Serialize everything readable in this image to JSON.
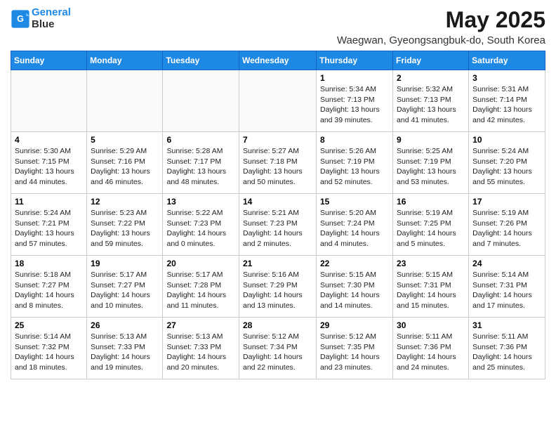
{
  "logo": {
    "line1": "General",
    "line2": "Blue"
  },
  "title": "May 2025",
  "subtitle": "Waegwan, Gyeongsangbuk-do, South Korea",
  "days_header": [
    "Sunday",
    "Monday",
    "Tuesday",
    "Wednesday",
    "Thursday",
    "Friday",
    "Saturday"
  ],
  "weeks": [
    [
      {
        "num": "",
        "info": "",
        "empty": true
      },
      {
        "num": "",
        "info": "",
        "empty": true
      },
      {
        "num": "",
        "info": "",
        "empty": true
      },
      {
        "num": "",
        "info": "",
        "empty": true
      },
      {
        "num": "1",
        "info": "Sunrise: 5:34 AM\nSunset: 7:13 PM\nDaylight: 13 hours\nand 39 minutes."
      },
      {
        "num": "2",
        "info": "Sunrise: 5:32 AM\nSunset: 7:13 PM\nDaylight: 13 hours\nand 41 minutes."
      },
      {
        "num": "3",
        "info": "Sunrise: 5:31 AM\nSunset: 7:14 PM\nDaylight: 13 hours\nand 42 minutes."
      }
    ],
    [
      {
        "num": "4",
        "info": "Sunrise: 5:30 AM\nSunset: 7:15 PM\nDaylight: 13 hours\nand 44 minutes."
      },
      {
        "num": "5",
        "info": "Sunrise: 5:29 AM\nSunset: 7:16 PM\nDaylight: 13 hours\nand 46 minutes."
      },
      {
        "num": "6",
        "info": "Sunrise: 5:28 AM\nSunset: 7:17 PM\nDaylight: 13 hours\nand 48 minutes."
      },
      {
        "num": "7",
        "info": "Sunrise: 5:27 AM\nSunset: 7:18 PM\nDaylight: 13 hours\nand 50 minutes."
      },
      {
        "num": "8",
        "info": "Sunrise: 5:26 AM\nSunset: 7:19 PM\nDaylight: 13 hours\nand 52 minutes."
      },
      {
        "num": "9",
        "info": "Sunrise: 5:25 AM\nSunset: 7:19 PM\nDaylight: 13 hours\nand 53 minutes."
      },
      {
        "num": "10",
        "info": "Sunrise: 5:24 AM\nSunset: 7:20 PM\nDaylight: 13 hours\nand 55 minutes."
      }
    ],
    [
      {
        "num": "11",
        "info": "Sunrise: 5:24 AM\nSunset: 7:21 PM\nDaylight: 13 hours\nand 57 minutes."
      },
      {
        "num": "12",
        "info": "Sunrise: 5:23 AM\nSunset: 7:22 PM\nDaylight: 13 hours\nand 59 minutes."
      },
      {
        "num": "13",
        "info": "Sunrise: 5:22 AM\nSunset: 7:23 PM\nDaylight: 14 hours\nand 0 minutes."
      },
      {
        "num": "14",
        "info": "Sunrise: 5:21 AM\nSunset: 7:23 PM\nDaylight: 14 hours\nand 2 minutes."
      },
      {
        "num": "15",
        "info": "Sunrise: 5:20 AM\nSunset: 7:24 PM\nDaylight: 14 hours\nand 4 minutes."
      },
      {
        "num": "16",
        "info": "Sunrise: 5:19 AM\nSunset: 7:25 PM\nDaylight: 14 hours\nand 5 minutes."
      },
      {
        "num": "17",
        "info": "Sunrise: 5:19 AM\nSunset: 7:26 PM\nDaylight: 14 hours\nand 7 minutes."
      }
    ],
    [
      {
        "num": "18",
        "info": "Sunrise: 5:18 AM\nSunset: 7:27 PM\nDaylight: 14 hours\nand 8 minutes."
      },
      {
        "num": "19",
        "info": "Sunrise: 5:17 AM\nSunset: 7:27 PM\nDaylight: 14 hours\nand 10 minutes."
      },
      {
        "num": "20",
        "info": "Sunrise: 5:17 AM\nSunset: 7:28 PM\nDaylight: 14 hours\nand 11 minutes."
      },
      {
        "num": "21",
        "info": "Sunrise: 5:16 AM\nSunset: 7:29 PM\nDaylight: 14 hours\nand 13 minutes."
      },
      {
        "num": "22",
        "info": "Sunrise: 5:15 AM\nSunset: 7:30 PM\nDaylight: 14 hours\nand 14 minutes."
      },
      {
        "num": "23",
        "info": "Sunrise: 5:15 AM\nSunset: 7:31 PM\nDaylight: 14 hours\nand 15 minutes."
      },
      {
        "num": "24",
        "info": "Sunrise: 5:14 AM\nSunset: 7:31 PM\nDaylight: 14 hours\nand 17 minutes."
      }
    ],
    [
      {
        "num": "25",
        "info": "Sunrise: 5:14 AM\nSunset: 7:32 PM\nDaylight: 14 hours\nand 18 minutes."
      },
      {
        "num": "26",
        "info": "Sunrise: 5:13 AM\nSunset: 7:33 PM\nDaylight: 14 hours\nand 19 minutes."
      },
      {
        "num": "27",
        "info": "Sunrise: 5:13 AM\nSunset: 7:33 PM\nDaylight: 14 hours\nand 20 minutes."
      },
      {
        "num": "28",
        "info": "Sunrise: 5:12 AM\nSunset: 7:34 PM\nDaylight: 14 hours\nand 22 minutes."
      },
      {
        "num": "29",
        "info": "Sunrise: 5:12 AM\nSunset: 7:35 PM\nDaylight: 14 hours\nand 23 minutes."
      },
      {
        "num": "30",
        "info": "Sunrise: 5:11 AM\nSunset: 7:36 PM\nDaylight: 14 hours\nand 24 minutes."
      },
      {
        "num": "31",
        "info": "Sunrise: 5:11 AM\nSunset: 7:36 PM\nDaylight: 14 hours\nand 25 minutes."
      }
    ]
  ]
}
